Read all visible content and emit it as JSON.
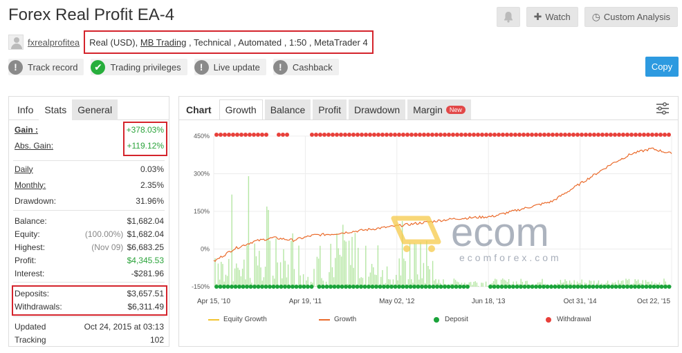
{
  "page": {
    "title": "Forex Real Profit EA-4",
    "username": "fxrealprofitea",
    "account": {
      "type": "Real (USD),",
      "broker": "MB Trading",
      "rest": ", Technical , Automated , 1:50 , MetaTrader 4"
    }
  },
  "top_buttons": {
    "watch": "Watch",
    "custom_analysis": "Custom Analysis",
    "copy": "Copy"
  },
  "badges": [
    {
      "label": "Track record",
      "status": "!"
    },
    {
      "label": "Trading privileges",
      "status": "✔"
    },
    {
      "label": "Live update",
      "status": "!"
    },
    {
      "label": "Cashback",
      "status": "!"
    }
  ],
  "left_tabs": {
    "info": "Info",
    "stats": "Stats",
    "general": "General"
  },
  "stats": {
    "gain": {
      "label": "Gain :",
      "value": "+378.03%"
    },
    "abs_gain": {
      "label": "Abs. Gain:",
      "value": "+119.12%"
    },
    "daily": {
      "label": "Daily",
      "value": "0.03%"
    },
    "monthly": {
      "label": "Monthly:",
      "value": "2.35%"
    },
    "drawdown": {
      "label": "Drawdown:",
      "value": "31.96%"
    },
    "balance": {
      "label": "Balance:",
      "value": "$1,682.04"
    },
    "equity": {
      "label": "Equity:",
      "note": "(100.00%)",
      "value": "$1,682.04"
    },
    "highest": {
      "label": "Highest:",
      "note": "(Nov 09)",
      "value": "$6,683.25"
    },
    "profit": {
      "label": "Profit:",
      "value": "$4,345.53"
    },
    "interest": {
      "label": "Interest:",
      "value": "-$281.96"
    },
    "deposits": {
      "label": "Deposits:",
      "value": "$3,657.51"
    },
    "withdrawals": {
      "label": "Withdrawals:",
      "value": "$6,311.49"
    },
    "updated": {
      "label": "Updated",
      "value": "Oct 24, 2015 at 03:13"
    },
    "tracking": {
      "label": "Tracking",
      "value": "102"
    }
  },
  "right_tabs": {
    "chart": "Chart",
    "growth": "Growth",
    "balance": "Balance",
    "profit": "Profit",
    "drawdown": "Drawdown",
    "margin": "Margin",
    "new_tag": "New"
  },
  "watermark": {
    "brand": "ecomforex.com"
  },
  "colors": {
    "growth": "#ea6a2a",
    "equity": "#f2c32e",
    "deposit": "#1aa33a",
    "withdrawal": "#e8403a",
    "bars": "#9bde84"
  },
  "chart_data": {
    "type": "line",
    "y_ticks": [
      "450%",
      "300%",
      "150%",
      "0%",
      "-150%"
    ],
    "ylim": [
      -150,
      450
    ],
    "x_ticks": [
      "Apr 15, '10",
      "Apr 19, '11",
      "May 02, '12",
      "Jun 18, '13",
      "Oct 31, '14",
      "Oct 22, '15"
    ],
    "legend_position": "bottom",
    "series": [
      {
        "name": "Equity Growth",
        "values": []
      },
      {
        "name": "Growth",
        "values": [
          -50,
          0,
          30,
          45,
          35,
          55,
          60,
          70,
          80,
          90,
          100,
          110,
          120,
          125,
          130,
          150,
          170,
          190,
          240,
          290,
          340,
          380,
          400,
          380
        ]
      },
      {
        "name": "Deposit",
        "values": []
      },
      {
        "name": "Withdrawal",
        "values": []
      }
    ]
  }
}
